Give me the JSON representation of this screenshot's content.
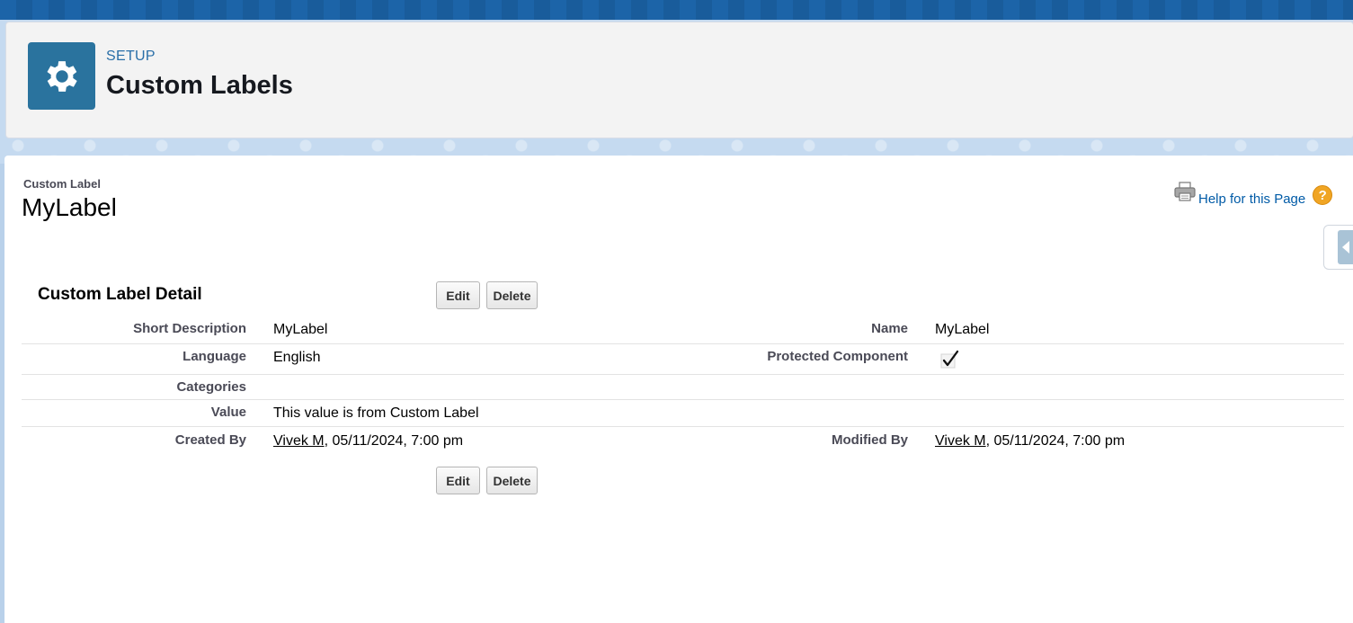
{
  "header": {
    "section_label": "SETUP",
    "title": "Custom Labels",
    "icon": "gear-icon"
  },
  "record": {
    "type_label": "Custom Label",
    "name": "MyLabel"
  },
  "help": {
    "link_text": "Help for this Page",
    "print_icon": "printer-icon",
    "help_icon": "question-icon",
    "help_glyph": "?"
  },
  "detail": {
    "title": "Custom Label Detail",
    "edit_label": "Edit",
    "delete_label": "Delete",
    "fields": {
      "short_description": {
        "label": "Short Description",
        "value": "MyLabel"
      },
      "name": {
        "label": "Name",
        "value": "MyLabel"
      },
      "language": {
        "label": "Language",
        "value": "English"
      },
      "protected_component": {
        "label": "Protected Component",
        "checked": true
      },
      "categories": {
        "label": "Categories",
        "value": ""
      },
      "value": {
        "label": "Value",
        "value": "This value is from Custom Label"
      },
      "created_by": {
        "label": "Created By",
        "user": "Vivek M",
        "timestamp": ", 05/11/2024, 7:00 pm"
      },
      "modified_by": {
        "label": "Modified By",
        "user": "Vivek M",
        "timestamp": ", 05/11/2024, 7:00 pm"
      }
    }
  },
  "colors": {
    "brand_blue": "#2a739e",
    "link_blue": "#015ba7",
    "help_orange": "#f0a524"
  }
}
